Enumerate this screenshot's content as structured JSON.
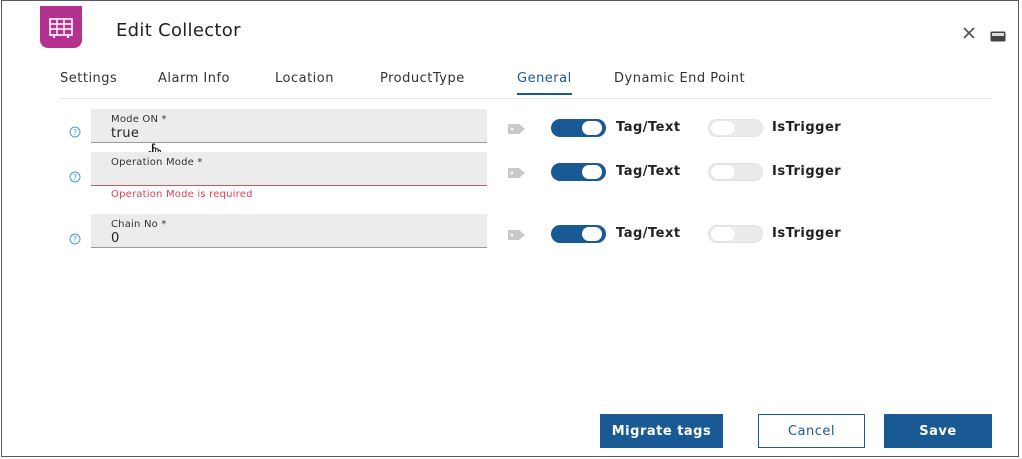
{
  "dialog": {
    "title": "Edit Collector",
    "app_icon": "collector-grid-icon",
    "window_controls": [
      "close-icon",
      "minimize-icon"
    ]
  },
  "tabs": [
    {
      "label": "Settings",
      "active": false
    },
    {
      "label": "Alarm Info",
      "active": false
    },
    {
      "label": "Location",
      "active": false
    },
    {
      "label": "ProductType",
      "active": false
    },
    {
      "label": "General",
      "active": true
    },
    {
      "label": "Dynamic End Point",
      "active": false
    }
  ],
  "fields": [
    {
      "label": "Mode ON *",
      "value": "true",
      "tag_text": true,
      "is_trigger": false
    },
    {
      "label": "Operation Mode *",
      "value": "",
      "error": "Operation Mode is required",
      "tag_text": true,
      "is_trigger": false
    },
    {
      "label": "Chain No *",
      "value": "0",
      "tag_text": true,
      "is_trigger": false
    }
  ],
  "toggle_labels": {
    "tag_text": "Tag/Text",
    "is_trigger": "IsTrigger"
  },
  "footer": {
    "migrate_label": "Migrate tags",
    "cancel_label": "Cancel",
    "save_label": "Save"
  },
  "colors": {
    "accent": "#1a5a94",
    "app_icon_bg": "#b5318f",
    "error": "#e0414f"
  }
}
